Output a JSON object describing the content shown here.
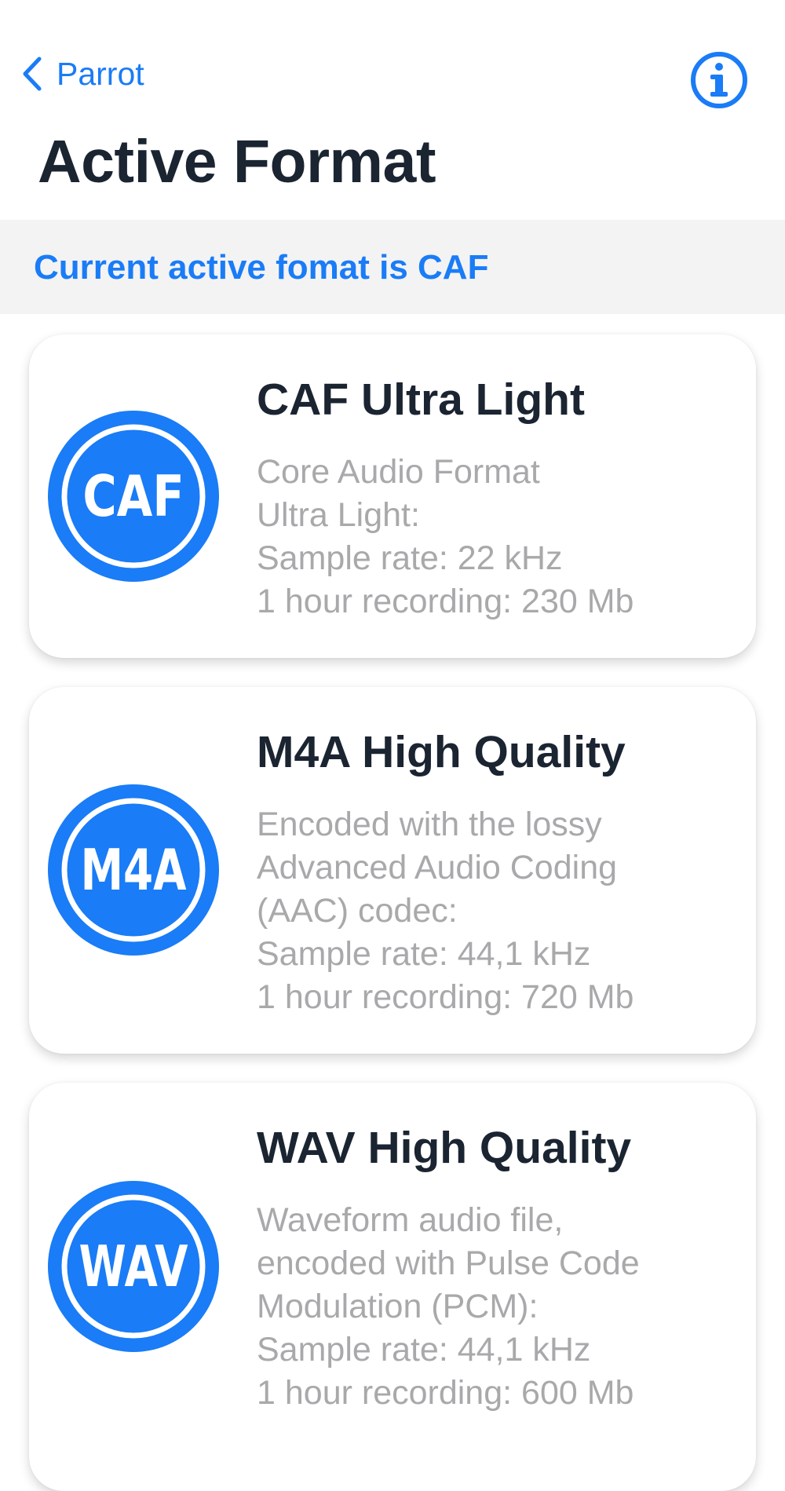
{
  "nav": {
    "back_label": "Parrot",
    "back_icon": "chevron-left-icon",
    "info_icon": "info-circle-icon"
  },
  "page_title": "Active Format",
  "banner": {
    "text": "Current active fomat is CAF"
  },
  "colors": {
    "accent": "#1a7cf6",
    "title_text": "#1b2431",
    "secondary_text": "#a9a9ab",
    "banner_bg": "#f3f3f4"
  },
  "formats": [
    {
      "badge": "CAF",
      "title": "CAF Ultra Light",
      "lines": [
        "Core Audio Format",
        "Ultra Light:",
        "Sample rate: 22 kHz",
        "1 hour recording: 230 Mb"
      ]
    },
    {
      "badge": "M4A",
      "title": "M4A High Quality",
      "lines": [
        "Encoded with the lossy",
        "Advanced Audio Coding",
        "(AAC) codec:",
        "Sample rate: 44,1 kHz",
        "1 hour recording: 720 Mb"
      ]
    },
    {
      "badge": "WAV",
      "title": "WAV High Quality",
      "lines": [
        "Waveform audio file,",
        "encoded with Pulse Code",
        "Modulation (PCM):",
        "Sample rate: 44,1 kHz",
        "1 hour recording: 600 Mb"
      ]
    }
  ]
}
